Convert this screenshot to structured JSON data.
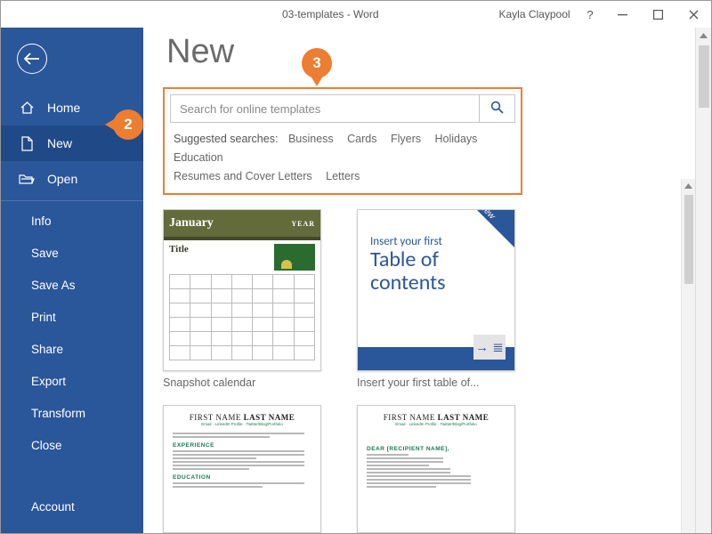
{
  "window": {
    "title": "03-templates - Word",
    "user_name": "Kayla Claypool"
  },
  "callouts": {
    "c2": "2",
    "c3": "3"
  },
  "sidebar": {
    "items": [
      {
        "label": "Home",
        "icon": "home-icon"
      },
      {
        "label": "New",
        "icon": "page-icon",
        "selected": true
      },
      {
        "label": "Open",
        "icon": "folder-icon"
      }
    ],
    "secondary": [
      {
        "label": "Info"
      },
      {
        "label": "Save"
      },
      {
        "label": "Save As"
      },
      {
        "label": "Print"
      },
      {
        "label": "Share"
      },
      {
        "label": "Export"
      },
      {
        "label": "Transform"
      },
      {
        "label": "Close"
      }
    ],
    "account_label": "Account"
  },
  "page": {
    "title": "New",
    "search_placeholder": "Search for online templates",
    "suggested_label": "Suggested searches:",
    "suggested_terms": [
      "Business",
      "Cards",
      "Flyers",
      "Holidays",
      "Education",
      "Resumes and Cover Letters",
      "Letters"
    ],
    "templates": [
      {
        "label": "Snapshot calendar",
        "thumb_month": "January",
        "thumb_year": "YEAR",
        "thumb_title": "Title"
      },
      {
        "label": "Insert your first table of...",
        "banner": "New",
        "thumb_line1": "Insert your first",
        "thumb_line2": "Table of",
        "thumb_line3": "contents",
        "slip_glyph": "→ ≣"
      },
      {
        "label": "",
        "resume_first": "FIRST NAME",
        "resume_last": "LAST NAME",
        "resume_sub": "Email · LinkedIn Profile · Twitter/Blog/Portfolio",
        "sections": [
          "EXPERIENCE",
          "EDUCATION"
        ]
      },
      {
        "label": "",
        "resume_first": "FIRST NAME",
        "resume_last": "LAST NAME",
        "resume_sub": "Email · LinkedIn Profile · Twitter/Blog/Portfolio",
        "sections": [
          "DEAR [RECIPIENT NAME],"
        ]
      }
    ]
  }
}
